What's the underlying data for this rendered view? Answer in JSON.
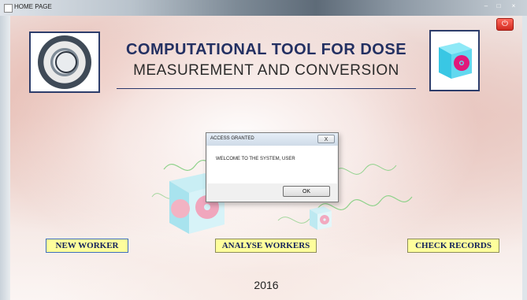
{
  "window": {
    "title": "HOME PAGE"
  },
  "header": {
    "title_line1": "COMPUTATIONAL TOOL FOR DOSE",
    "title_line2": "MEASUREMENT AND CONVERSION"
  },
  "dialog": {
    "title": "ACCESS GRANTED",
    "message": "WELCOME TO THE SYSTEM, USER",
    "ok_label": "OK",
    "close_label": "X"
  },
  "buttons": {
    "new_worker": "NEW WORKER",
    "analyse_workers": "ANALYSE WORKERS",
    "check_records": "CHECK RECORDS"
  },
  "footer": {
    "year": "2016"
  },
  "colors": {
    "title_navy": "#233062",
    "button_yellow": "#fefe9c",
    "radiation_magenta": "#e0187a",
    "cube_cyan": "#5fd8f0"
  }
}
